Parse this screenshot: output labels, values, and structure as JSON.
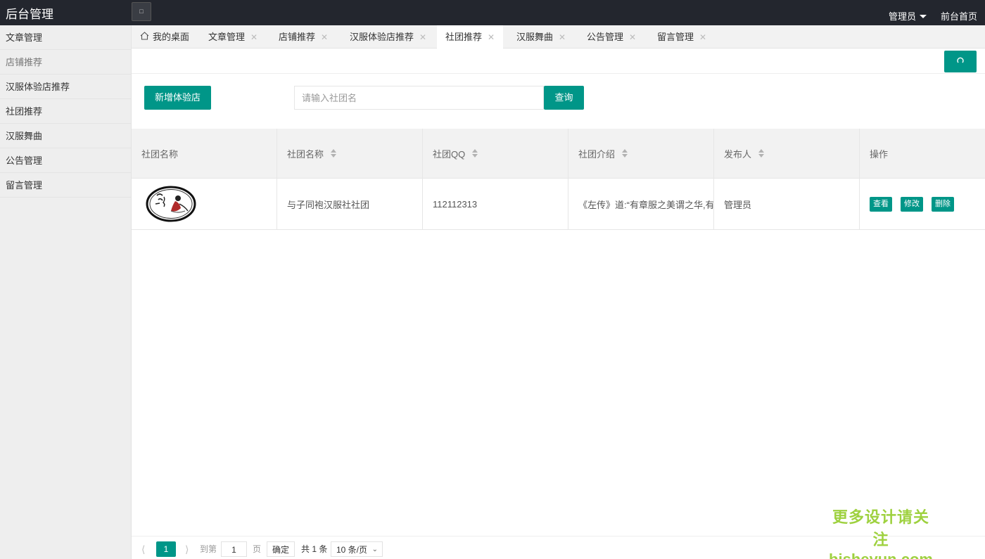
{
  "app": {
    "title": "后台管理",
    "flex_icon": "square-icon",
    "admin_label": "管理员",
    "front_link": "前台首页"
  },
  "sidebar": {
    "items": [
      {
        "label": "文章管理"
      },
      {
        "label": "店铺推荐"
      },
      {
        "label": "汉服体验店推荐"
      },
      {
        "label": "社团推荐"
      },
      {
        "label": "汉服舞曲"
      },
      {
        "label": "公告管理"
      },
      {
        "label": "留言管理"
      }
    ]
  },
  "tabs": [
    {
      "label": "我的桌面",
      "icon": "home-icon"
    },
    {
      "label": "文章管理"
    },
    {
      "label": "店铺推荐"
    },
    {
      "label": "汉服体验店推荐"
    },
    {
      "label": "社团推荐",
      "active": true
    },
    {
      "label": "汉服舞曲"
    },
    {
      "label": "公告管理"
    },
    {
      "label": "留言管理"
    }
  ],
  "refresh_icon": "refresh-icon",
  "toolbar": {
    "add_label": "新增体验店",
    "search_placeholder": "请输入社团名",
    "query_label": "查询"
  },
  "table": {
    "headers": [
      "社团名称",
      "社团名称",
      "社团QQ",
      "社团介绍",
      "发布人",
      "操作"
    ],
    "rows": [
      {
        "name": "与子同袍汉服社社团",
        "qq": "112112313",
        "intro": "《左传》道:“有章服之美谓之华,有礼仪之大故称夏”",
        "publisher": "管理员",
        "actions": {
          "view": "查看",
          "edit": "修改",
          "delete": "删除"
        }
      }
    ]
  },
  "pager": {
    "current": "1",
    "goto_label": "到第",
    "goto_value": "1",
    "page_label": "页",
    "confirm_label": "确定",
    "total_label": "共 1 条",
    "page_size": "10 条/页"
  },
  "watermark": {
    "line1": "更多设计请关注",
    "line2": "bisheyun.com"
  },
  "colors": {
    "topbar": "#23262e",
    "accent": "#009688",
    "sidebar": "#eeeeee"
  }
}
